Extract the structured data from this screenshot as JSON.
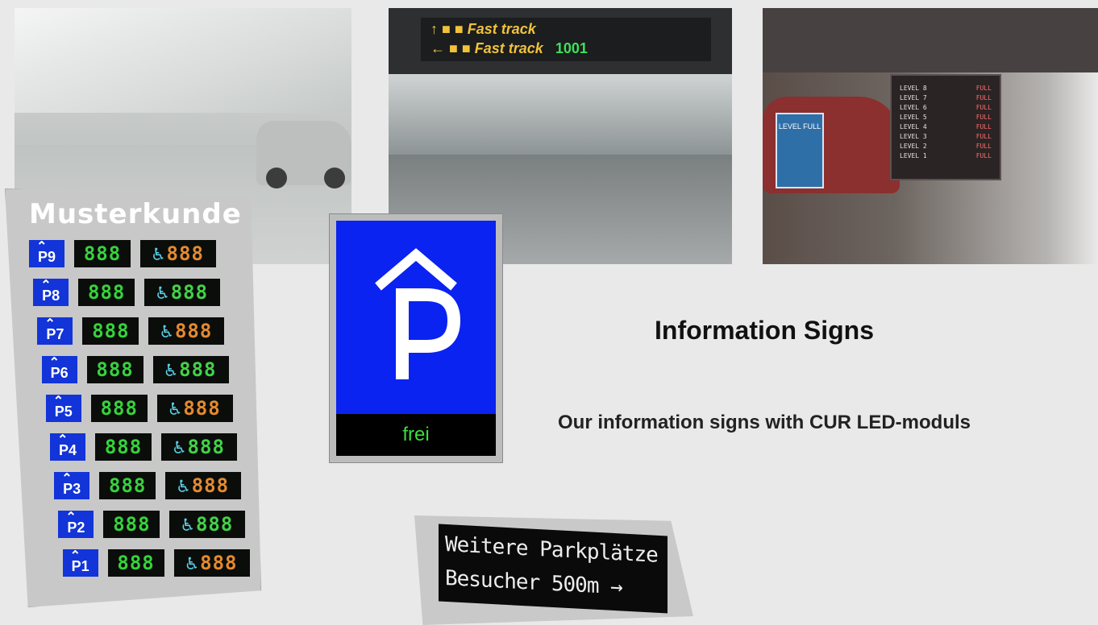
{
  "photo1": {
    "alt": "garage-photo-left"
  },
  "photo2": {
    "sign_line1": "Fast track",
    "sign_line2": "Fast track",
    "sign_counter": "1001"
  },
  "photo3": {
    "board_rows": [
      {
        "level": "LEVEL 8",
        "status": "FULL"
      },
      {
        "level": "LEVEL 7",
        "status": "FULL"
      },
      {
        "level": "LEVEL 6",
        "status": "FULL"
      },
      {
        "level": "LEVEL 5",
        "status": "FULL"
      },
      {
        "level": "LEVEL 4",
        "status": "FULL"
      },
      {
        "level": "LEVEL 3",
        "status": "FULL"
      },
      {
        "level": "LEVEL 2",
        "status": "FULL"
      },
      {
        "level": "LEVEL 1",
        "status": "FULL"
      }
    ],
    "blue_sign": "LEVEL FULL"
  },
  "left_panel": {
    "title": "Musterkunde",
    "rows": [
      {
        "label": "P9",
        "d1": "888",
        "d2": "888"
      },
      {
        "label": "P8",
        "d1": "888",
        "d2": "888"
      },
      {
        "label": "P7",
        "d1": "888",
        "d2": "888"
      },
      {
        "label": "P6",
        "d1": "888",
        "d2": "888"
      },
      {
        "label": "P5",
        "d1": "888",
        "d2": "888"
      },
      {
        "label": "P4",
        "d1": "888",
        "d2": "888"
      },
      {
        "label": "P3",
        "d1": "888",
        "d2": "888"
      },
      {
        "label": "P2",
        "d1": "888",
        "d2": "888"
      },
      {
        "label": "P1",
        "d1": "888",
        "d2": "888"
      }
    ],
    "wheelchair_icon": "wheelchair-icon"
  },
  "parking_sign": {
    "letter": "P",
    "status": "frei",
    "colors": {
      "panel": "#0a23f0",
      "status_text": "#3adf3a"
    }
  },
  "heading": "Information Signs",
  "description": "Our information signs with CUR LED-moduls",
  "led_sign": {
    "line1": "Weitere Parkplätze",
    "line2": "Besucher 500m →"
  }
}
